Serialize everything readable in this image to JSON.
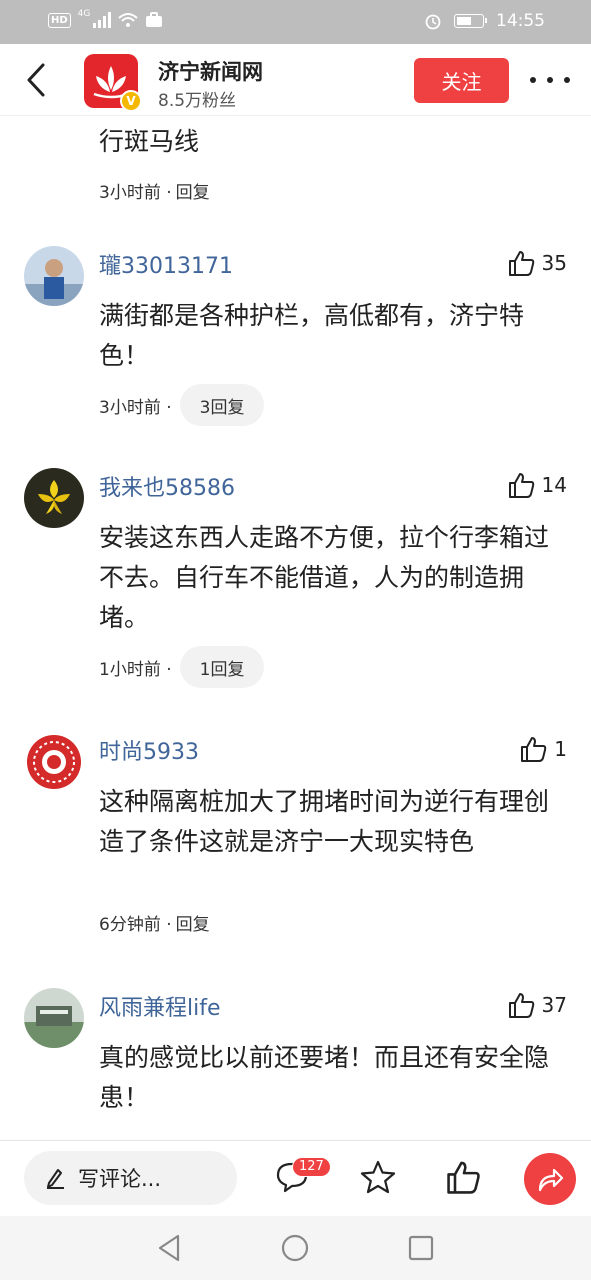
{
  "status_bar": {
    "left_badge": "HD",
    "network": "4G",
    "time": "14:55",
    "battery_level": 0.6
  },
  "header": {
    "back_icon": "chevron-left-icon",
    "channel_name": "济宁新闻网",
    "fans": "8.5万粉丝",
    "verified_badge": "V",
    "follow_label": "关注",
    "more_icon": "more-dots-icon",
    "accent_color": "#f04142"
  },
  "comments": [
    {
      "name": "",
      "text": "行斑马线",
      "time": "3小时前 ·",
      "reply": "回复",
      "likes": ""
    },
    {
      "name": "瓏33013171",
      "text": "满街都是各种护栏，高低都有，济宁特色！",
      "time": "3小时前 ·",
      "reply": "3回复",
      "likes": "35"
    },
    {
      "name": "我来也58586",
      "text": "安装这东西人走路不方便，拉个行李箱过不去。自行车不能借道，人为的制造拥堵。",
      "time": "1小时前 ·",
      "reply": "1回复",
      "likes": "14"
    },
    {
      "name": "时尚5933",
      "text": "这种隔离桩加大了拥堵时间为逆行有理创造了条件这就是济宁一大现实特色",
      "time": "6分钟前 ·",
      "reply": "回复",
      "likes": "1"
    },
    {
      "name": "风雨兼程life",
      "text": "真的感觉比以前还要堵！而且还有安全隐患！",
      "time": "",
      "reply": "",
      "likes": "37"
    }
  ],
  "action_bar": {
    "write_placeholder": "写评论...",
    "comment_count": "127",
    "icons": [
      "pencil-icon",
      "comment-icon",
      "star-icon",
      "thumbs-up-icon",
      "share-icon"
    ]
  },
  "nav_bar": {
    "icons": [
      "back-triangle-icon",
      "home-circle-icon",
      "recents-square-icon"
    ]
  }
}
